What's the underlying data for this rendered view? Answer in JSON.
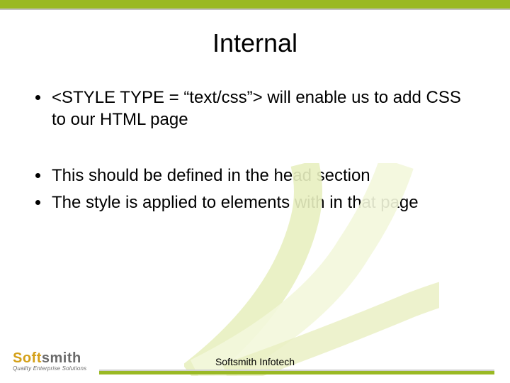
{
  "title": "Internal",
  "bullets": [
    "<STYLE TYPE = “text/css”> will enable us to add CSS to our HTML page",
    "This should be defined in the head section",
    "The style is applied to elements with in that page"
  ],
  "footer": "Softsmith Infotech",
  "logo": {
    "part1": "Soft",
    "part2": "smith",
    "tagline": "Quality Enterprise Solutions"
  }
}
